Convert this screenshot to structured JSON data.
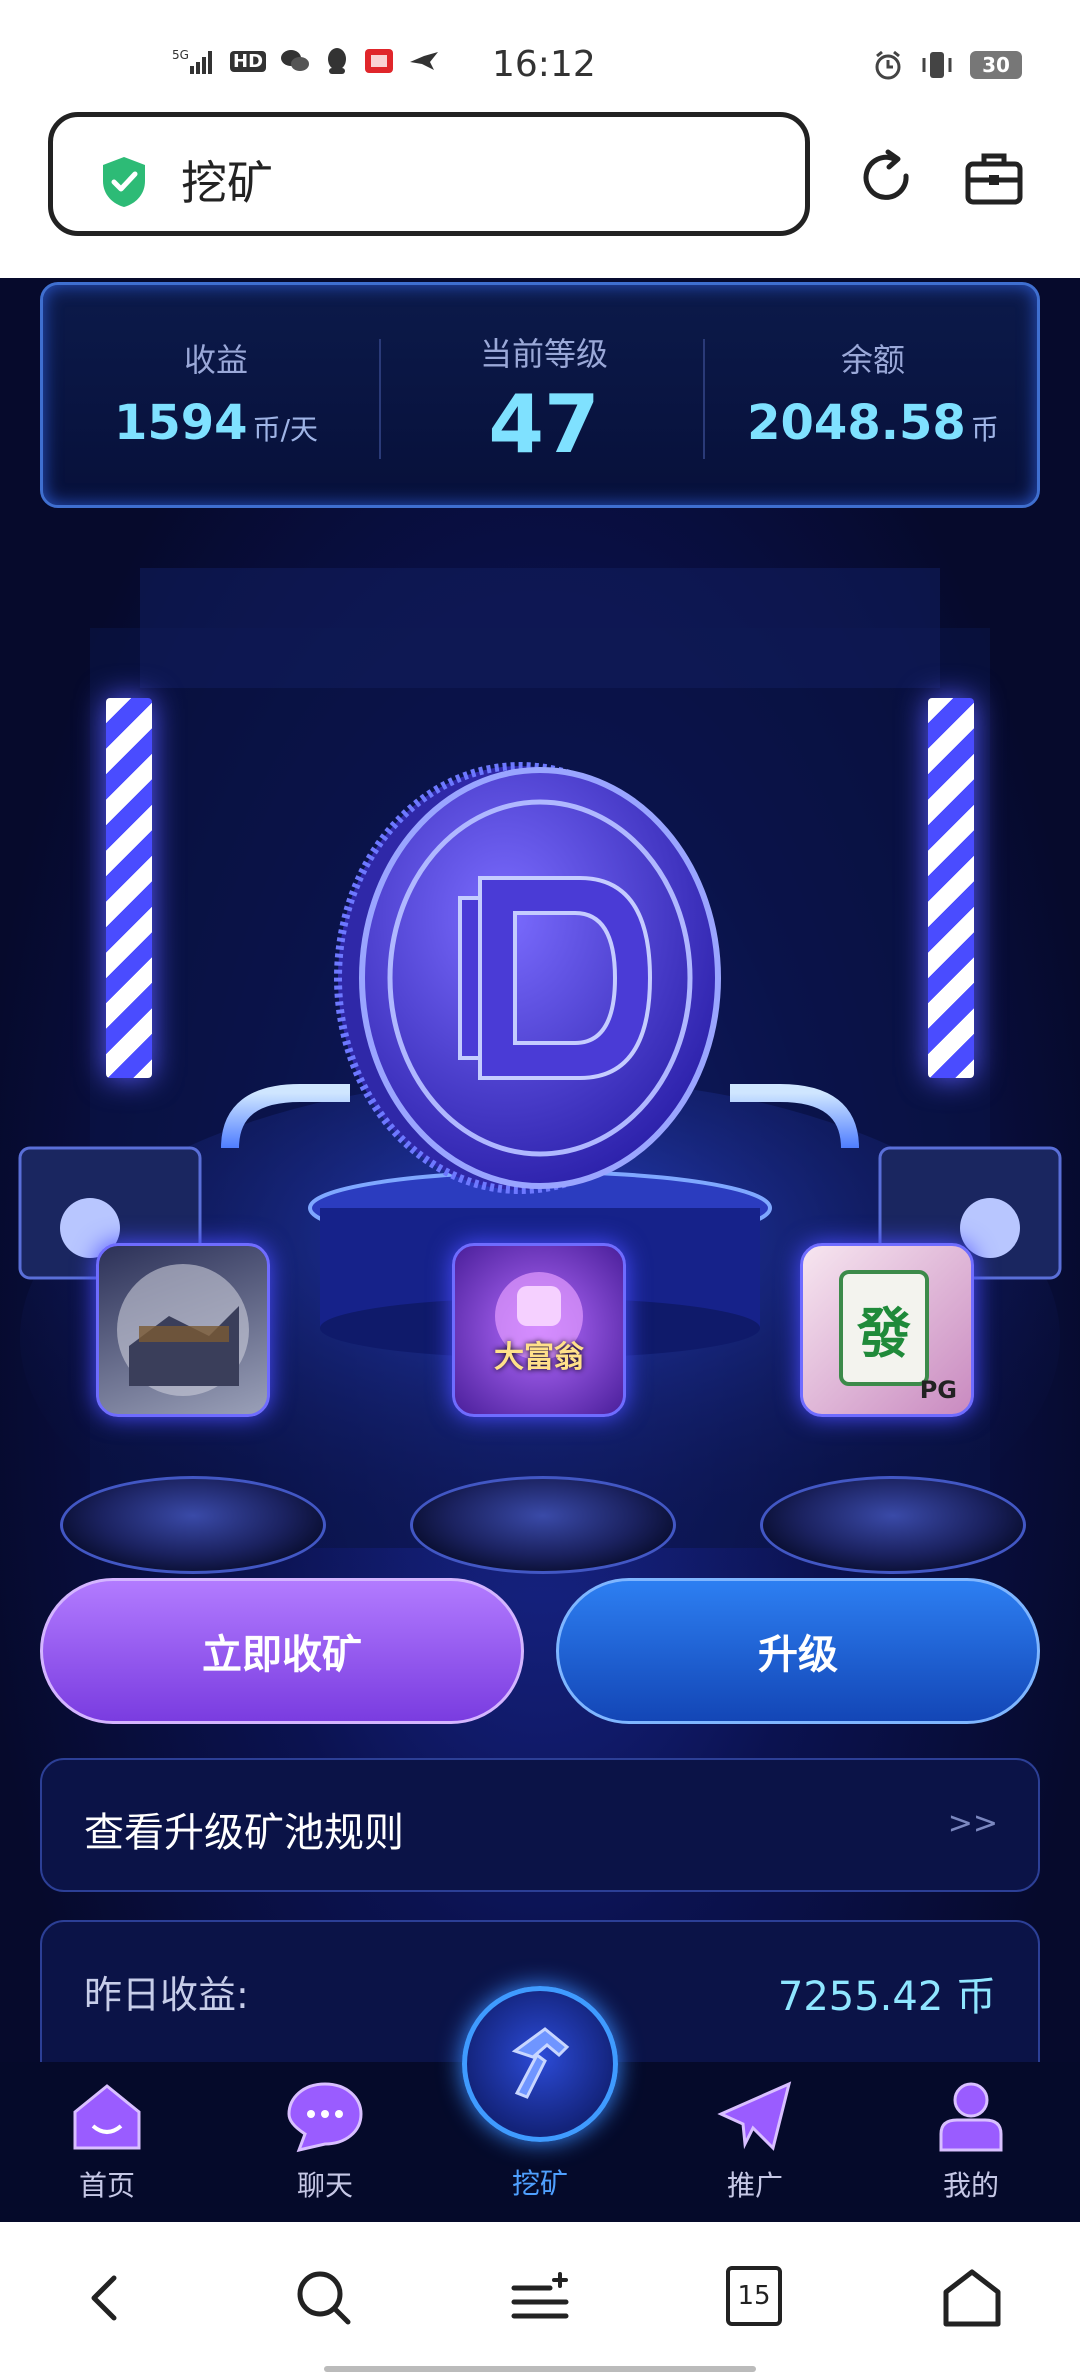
{
  "status_bar": {
    "time": "16:12",
    "network": "5G",
    "hd": "HD",
    "battery": "30"
  },
  "browser": {
    "url_title": "挖矿"
  },
  "stats": {
    "income_label": "收益",
    "income_value": "1594",
    "income_unit": "币/天",
    "level_label": "当前等级",
    "level_value": "47",
    "balance_label": "余额",
    "balance_value": "2048.58",
    "balance_unit": "币"
  },
  "games": [
    {
      "name": "",
      "color": "#8a8d9c"
    },
    {
      "name": "大富翁",
      "color": "#7a3fcf"
    },
    {
      "name": "發",
      "badge": "PG",
      "color": "#e8c4de"
    }
  ],
  "actions": {
    "collect_label": "立即收矿",
    "upgrade_label": "升级"
  },
  "rules": {
    "label": "查看升级矿池规则",
    "arrow": ">>"
  },
  "income": {
    "yesterday_label": "昨日收益:",
    "yesterday_value": "7255.42 币"
  },
  "nav": {
    "home": "首页",
    "chat": "聊天",
    "mining": "挖矿",
    "promo": "推广",
    "mine": "我的"
  },
  "system_bar": {
    "tabs_count": "15"
  }
}
